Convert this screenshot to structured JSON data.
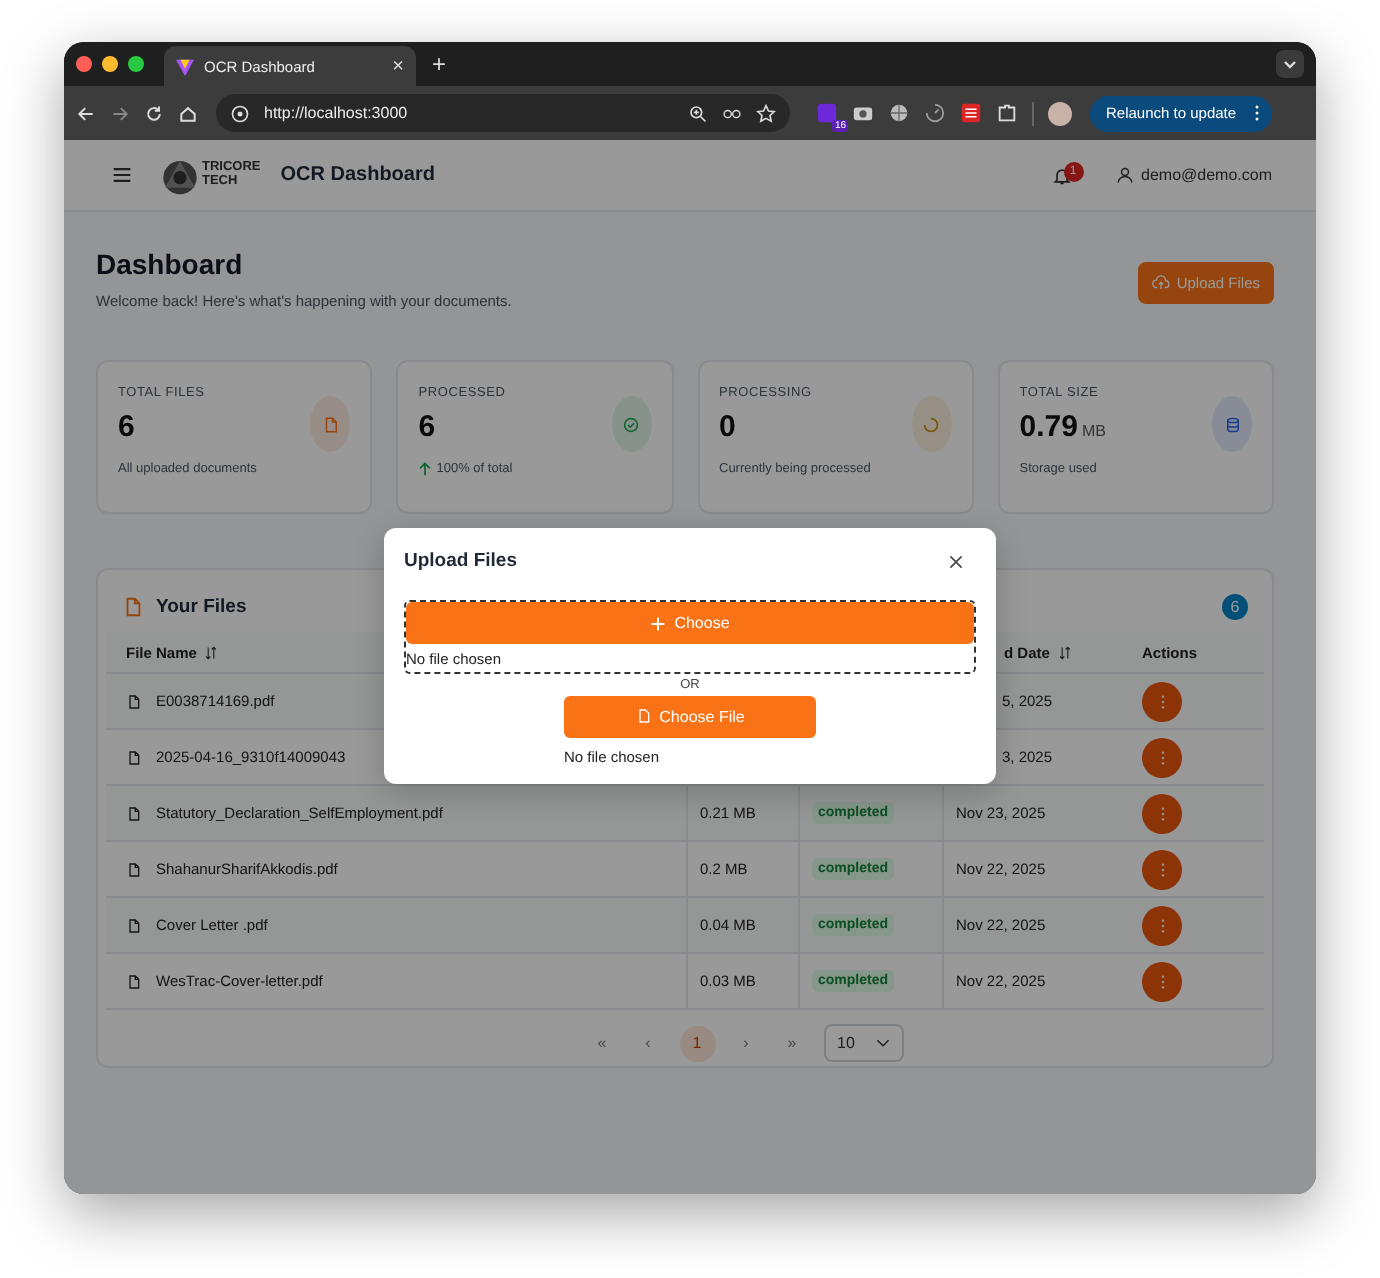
{
  "browser": {
    "tab_title": "OCR Dashboard",
    "tab_close": "×",
    "new_tab": "+",
    "url": "http://localhost:3000",
    "extension_badge": "16",
    "relaunch": "Relaunch to update"
  },
  "header": {
    "brand_line1": "TRICORE",
    "brand_line2": "TECH",
    "title": "OCR Dashboard",
    "notification_count": "1",
    "user": "demo@demo.com"
  },
  "page": {
    "title": "Dashboard",
    "subtitle": "Welcome back! Here's what's happening with your documents.",
    "upload_button": "Upload Files"
  },
  "cards": [
    {
      "label": "TOTAL FILES",
      "value": "6",
      "note": "All uploaded documents",
      "kind": "files",
      "trend": false
    },
    {
      "label": "PROCESSED",
      "value": "6",
      "note": "100% of total",
      "kind": "processed",
      "trend": true
    },
    {
      "label": "PROCESSING",
      "value": "0",
      "note": "Currently being processed",
      "kind": "processing",
      "trend": false
    },
    {
      "label": "TOTAL SIZE",
      "value": "0.79",
      "unit": "MB",
      "note": "Storage used",
      "kind": "storage",
      "trend": false
    }
  ],
  "files": {
    "title": "Your Files",
    "count": "6",
    "columns": [
      {
        "label": "File Name",
        "sortable": true
      },
      {
        "label": "d Date",
        "sortable": true
      },
      {
        "label": "Actions",
        "sortable": false
      }
    ],
    "rows": [
      {
        "name": "E0038714169.pdf",
        "date": "5, 2025"
      },
      {
        "name": "2025-04-16_9310f14009043",
        "date": "3, 2025"
      },
      {
        "name": "Statutory_Declaration_SelfEmployment.pdf",
        "size": "0.21 MB",
        "status": "completed",
        "date": "Nov 23, 2025"
      },
      {
        "name": "ShahanurSharifAkkodis.pdf",
        "size": "0.2 MB",
        "status": "completed",
        "date": "Nov 22, 2025"
      },
      {
        "name": "Cover Letter .pdf",
        "size": "0.04 MB",
        "status": "completed",
        "date": "Nov 22, 2025"
      },
      {
        "name": "WesTrac-Cover-letter.pdf",
        "size": "0.03 MB",
        "status": "completed",
        "date": "Nov 22, 2025"
      }
    ],
    "pagination": {
      "first": "«",
      "prev": "‹",
      "pages": [
        {
          "label": "1",
          "selected": true
        }
      ],
      "next": "›",
      "last": "»",
      "page_size": "10"
    }
  },
  "modal": {
    "title": "Upload Files",
    "choose_button": "Choose",
    "no_file_1": "No file chosen",
    "or": "OR",
    "choose_file_button": "Choose File",
    "no_file_2": "No file chosen"
  }
}
